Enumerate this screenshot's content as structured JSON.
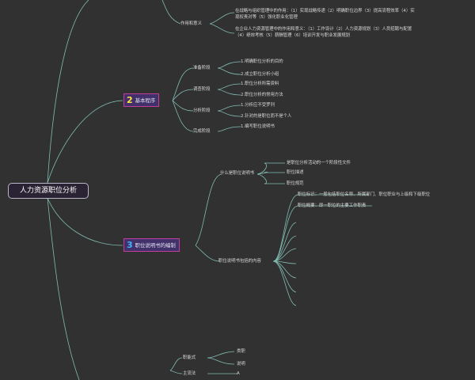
{
  "root": {
    "label": "人力资源职位分析"
  },
  "significance": {
    "label": "作用和意义",
    "lines": [
      "在战略与组织管理中的作用：（1）实现战略传递（2）明确职位边界（3）提高流程效率（4）实现权责对等（5）强化职业化管理",
      "在企业人力资源管理中的作用和意义：（1）工作设计（2）人力资源规划（3）人员招聘与配置（4）绩效考核（5）薪酬管理（6）培训开发与职业发展规划"
    ]
  },
  "section2": {
    "num": "2",
    "label": "基本程序",
    "groups": [
      {
        "label": "准备阶段",
        "items": [
          "1.明确职位分析的目的",
          "2.成立职位分析小组"
        ]
      },
      {
        "label": "调查阶段",
        "items": [
          "1.职位分析所需资料",
          "2.职位分析的常用方法"
        ]
      },
      {
        "label": "分析阶段",
        "items": [
          "1.分析应不受罗列",
          "2.针对的是职位而不是个人"
        ]
      },
      {
        "label": "完成阶段",
        "items": [
          "1.编写职位说明书"
        ]
      }
    ]
  },
  "section3": {
    "num": "3",
    "label": "职位说明书的编制",
    "what": {
      "label": "什么是职位说明书",
      "items": [
        "是职位分析活动的一个阶段性文件",
        "职位描述",
        "职位规范"
      ]
    },
    "contents": {
      "label": "职位说明书包括的内容",
      "items": [
        "职位标识：一般包括职位名称、所属部门、职位职业与上级和下级职位",
        "职位概要：即一职位的主要工作职责"
      ]
    }
  },
  "bottom": {
    "group1": {
      "label": "职能式",
      "items": [
        "类职",
        "说明"
      ]
    },
    "group2": {
      "label": "主流法",
      "items": [
        "A"
      ]
    }
  }
}
